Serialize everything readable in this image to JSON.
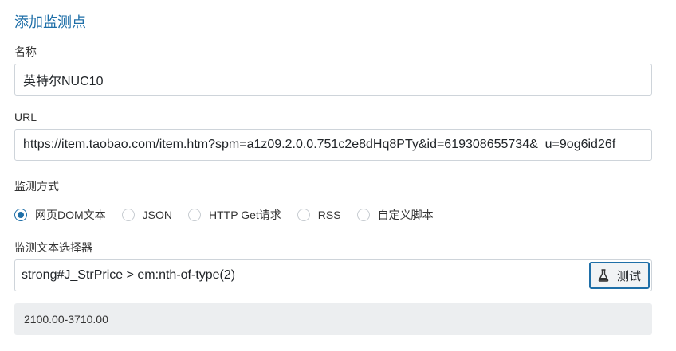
{
  "form": {
    "title": "添加监测点",
    "name_label": "名称",
    "name_value": "英特尔NUC10",
    "url_label": "URL",
    "url_value": "https://item.taobao.com/item.htm?spm=a1z09.2.0.0.751c2e8dHq8PTy&id=619308655734&_u=9og6id26f",
    "method_label": "监测方式",
    "methods": [
      {
        "label": "网页DOM文本",
        "checked": true
      },
      {
        "label": "JSON",
        "checked": false
      },
      {
        "label": "HTTP Get请求",
        "checked": false
      },
      {
        "label": "RSS",
        "checked": false
      },
      {
        "label": "自定义脚本",
        "checked": false
      }
    ],
    "selector_label": "监测文本选择器",
    "selector_value": "strong#J_StrPrice > em:nth-of-type(2)",
    "test_button_label": "测试",
    "result_value": "2100.00-3710.00"
  },
  "colors": {
    "accent": "#1f6fa8",
    "result_bg": "#eceef0"
  },
  "icons": {
    "test_button_icon": "flask-icon"
  }
}
